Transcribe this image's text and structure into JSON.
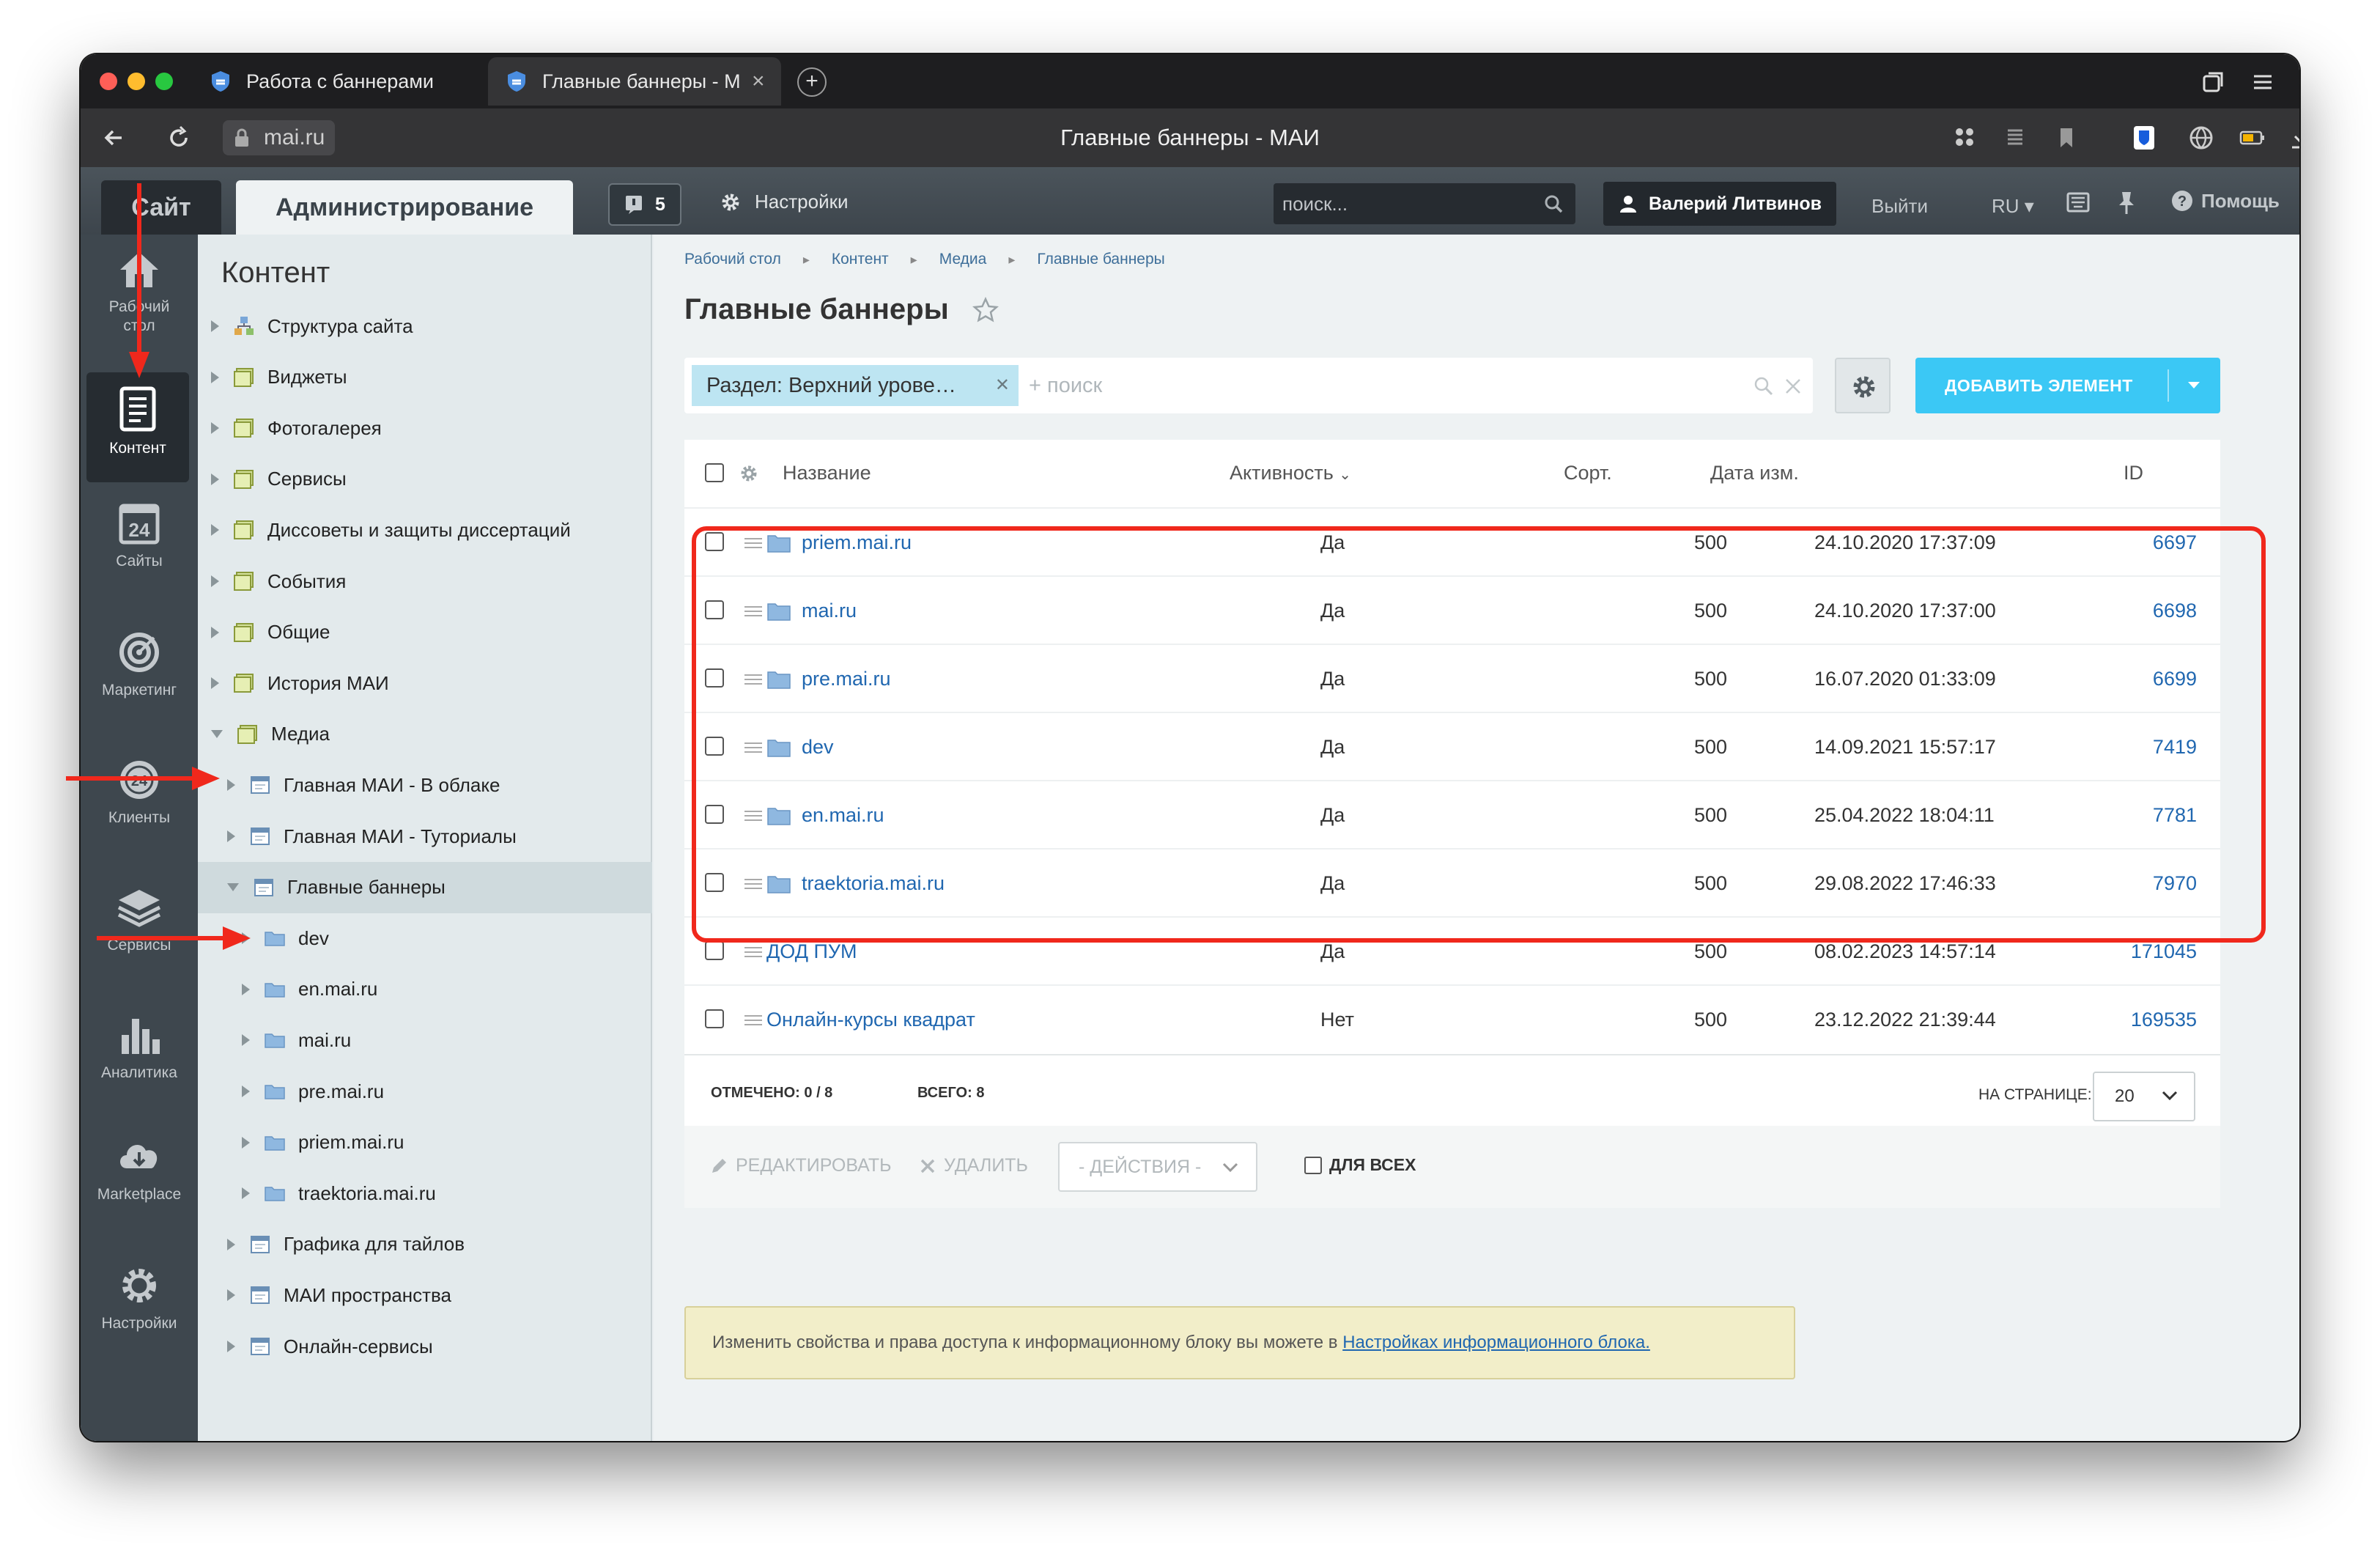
{
  "browser": {
    "tabs": [
      {
        "label": "Работа с баннерами"
      },
      {
        "label": "Главные баннеры - М"
      }
    ],
    "url": "mai.ru",
    "page_title": "Главные баннеры - МАИ"
  },
  "admin_header": {
    "site_button": "Сайт",
    "admin_button": "Администрирование",
    "notifications_count": "5",
    "settings": "Настройки",
    "search_placeholder": "поиск...",
    "user": "Валерий Литвинов",
    "logout": "Выйти",
    "language": "RU",
    "help": "Помощь"
  },
  "rail": [
    {
      "label": "Рабочий стол",
      "icon": "home-icon"
    },
    {
      "label": "Контент",
      "icon": "document-icon"
    },
    {
      "label": "Сайты",
      "icon": "sites-24-icon"
    },
    {
      "label": "Маркетинг",
      "icon": "target-icon"
    },
    {
      "label": "Клиенты",
      "icon": "clients-24-icon"
    },
    {
      "label": "Сервисы",
      "icon": "layers-icon"
    },
    {
      "label": "Аналитика",
      "icon": "bar-chart-icon"
    },
    {
      "label": "Marketplace",
      "icon": "cloud-download-icon"
    },
    {
      "label": "Настройки",
      "icon": "gear-icon"
    }
  ],
  "tree": {
    "title": "Контент",
    "items": [
      {
        "label": "Структура сайта"
      },
      {
        "label": "Виджеты"
      },
      {
        "label": "Фотогалерея"
      },
      {
        "label": "Сервисы"
      },
      {
        "label": "Диссоветы и защиты диссертаций"
      },
      {
        "label": "События"
      },
      {
        "label": "Общие"
      },
      {
        "label": "История МАИ"
      },
      {
        "label": "Медиа"
      },
      {
        "label": "Главная МАИ - В облаке"
      },
      {
        "label": "Главная МАИ - Туториалы"
      },
      {
        "label": "Главные баннеры"
      },
      {
        "label": "dev"
      },
      {
        "label": "en.mai.ru"
      },
      {
        "label": "mai.ru"
      },
      {
        "label": "pre.mai.ru"
      },
      {
        "label": "priem.mai.ru"
      },
      {
        "label": "traektoria.mai.ru"
      },
      {
        "label": "Графика для тайлов"
      },
      {
        "label": "МАИ пространства"
      },
      {
        "label": "Онлайн-сервисы"
      }
    ]
  },
  "breadcrumbs": [
    "Рабочий стол",
    "Контент",
    "Медиа",
    "Главные баннеры"
  ],
  "heading": "Главные баннеры",
  "filter": {
    "chip": "Раздел: Верхний урове…",
    "search_placeholder": "+ поиск"
  },
  "add_button": "ДОБАВИТЬ ЭЛЕМЕНТ",
  "table": {
    "columns": [
      "Название",
      "Активность",
      "Сорт.",
      "Дата изм.",
      "ID"
    ],
    "rows": [
      {
        "name": "priem.mai.ru",
        "active": "Да",
        "sort": "500",
        "date": "24.10.2020 17:37:09",
        "id": "6697",
        "folder": true
      },
      {
        "name": "mai.ru",
        "active": "Да",
        "sort": "500",
        "date": "24.10.2020 17:37:00",
        "id": "6698",
        "folder": true
      },
      {
        "name": "pre.mai.ru",
        "active": "Да",
        "sort": "500",
        "date": "16.07.2020 01:33:09",
        "id": "6699",
        "folder": true
      },
      {
        "name": "dev",
        "active": "Да",
        "sort": "500",
        "date": "14.09.2021 15:57:17",
        "id": "7419",
        "folder": true
      },
      {
        "name": "en.mai.ru",
        "active": "Да",
        "sort": "500",
        "date": "25.04.2022 18:04:11",
        "id": "7781",
        "folder": true
      },
      {
        "name": "traektoria.mai.ru",
        "active": "Да",
        "sort": "500",
        "date": "29.08.2022 17:46:33",
        "id": "7970",
        "folder": true
      },
      {
        "name": "ДОД ПУМ",
        "active": "Да",
        "sort": "500",
        "date": "08.02.2023 14:57:14",
        "id": "171045",
        "folder": false
      },
      {
        "name": "Онлайн-курсы квадрат",
        "active": "Нет",
        "sort": "500",
        "date": "23.12.2022 21:39:44",
        "id": "169535",
        "folder": false
      }
    ]
  },
  "footer": {
    "selected_label": "ОТМЕЧЕНО:",
    "selected_value": "0 / 8",
    "total_label": "ВСЕГО:",
    "total_value": "8",
    "per_page_label": "НА СТРАНИЦЕ:",
    "per_page_value": "20"
  },
  "actions": {
    "edit": "РЕДАКТИРОВАТЬ",
    "delete": "УДАЛИТЬ",
    "actions_select": "- ДЕЙСТВИЯ -",
    "for_all": "ДЛЯ ВСЕХ"
  },
  "notice": {
    "text": "Изменить свойства и права доступа к информационному блоку вы можете в ",
    "link": "Настройках информационного блока."
  },
  "colors": {
    "annotation_red": "#f0281c",
    "accent_blue": "#3bc8f5",
    "link_blue": "#2067b0"
  }
}
